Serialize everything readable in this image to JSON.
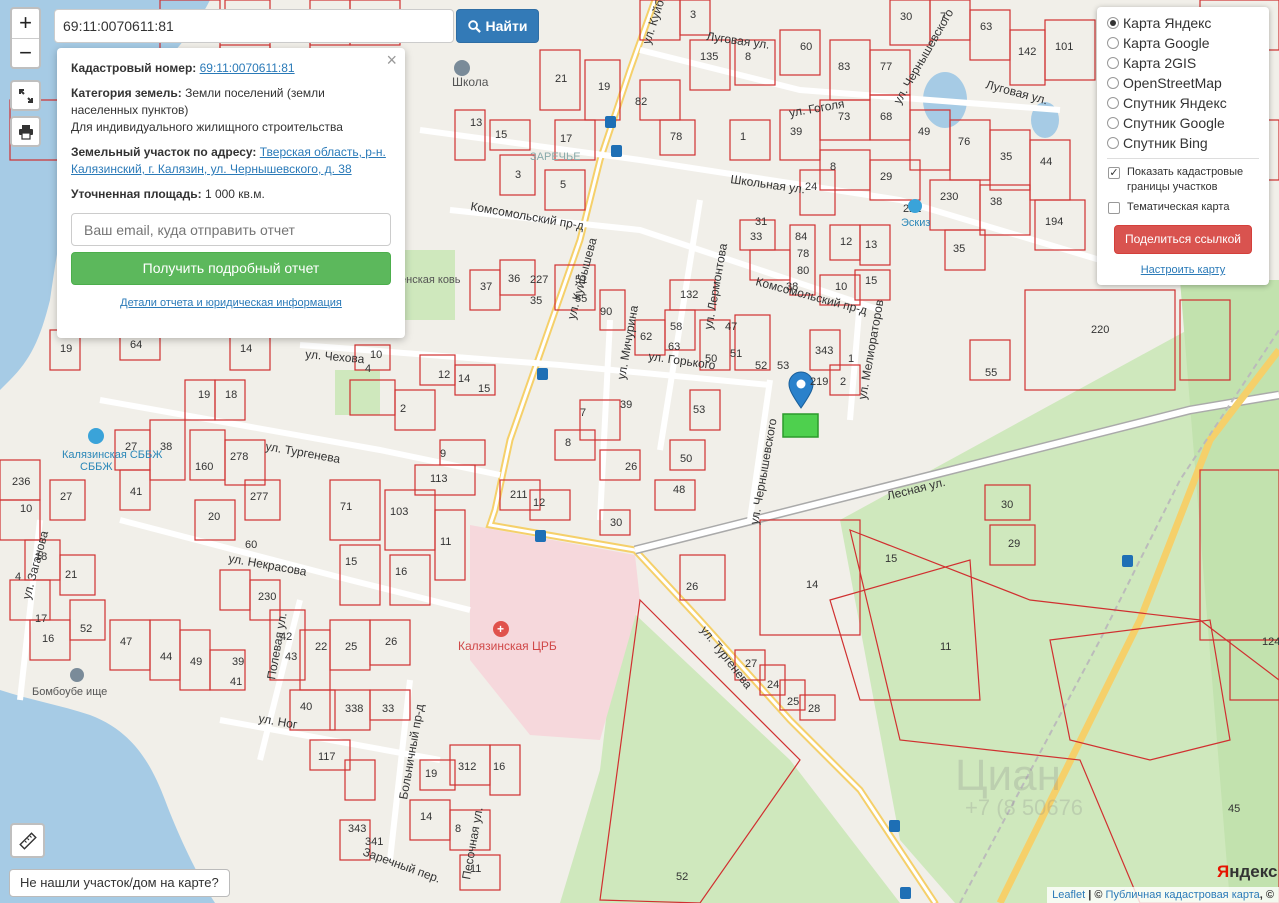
{
  "search": {
    "value": "69:11:0070611:81",
    "button_label": "Найти"
  },
  "zoom": {
    "in_label": "+",
    "out_label": "−"
  },
  "info_panel": {
    "cadastral_label": "Кадастровый номер:",
    "cadastral_value": "69:11:0070611:81",
    "category_label": "Категория земель:",
    "category_value": "Земли поселений (земли населенных пунктов)",
    "usage_value": "Для индивидуального жилищного строительства",
    "address_label": "Земельный участок по адресу:",
    "address_value": "Тверская область, р-н. Калязинский, г. Калязин, ул. Чернышевского, д. 38",
    "area_label": "Уточненная площадь:",
    "area_value": "1 000 кв.м.",
    "email_placeholder": "Ваш email, куда отправить отчет",
    "report_button": "Получить подробный отчет",
    "details_link": "Детали отчета и юридическая информация",
    "close": "×"
  },
  "layers": {
    "options": [
      {
        "label": "Карта Яндекс",
        "selected": true
      },
      {
        "label": "Карта Google",
        "selected": false
      },
      {
        "label": "Карта 2GIS",
        "selected": false
      },
      {
        "label": "OpenStreetMap",
        "selected": false
      },
      {
        "label": "Спутник Яндекс",
        "selected": false
      },
      {
        "label": "Спутник Google",
        "selected": false
      },
      {
        "label": "Спутник Bing",
        "selected": false
      }
    ],
    "show_borders_label": "Показать кадастровые границы участков",
    "show_borders": true,
    "thematic_label": "Тематическая карта",
    "thematic": false,
    "share_button": "Поделиться ссылкой",
    "configure_link": "Настроить карту"
  },
  "not_found_button": "Не нашли участок/дом на карте?",
  "attribution": {
    "leaflet": "Leaflet",
    "separator": " | © ",
    "source": "Публичная кадастровая карта",
    "suffix": ", ©"
  },
  "yandex_logo": {
    "first": "Я",
    "rest": "ндекс"
  },
  "map_labels": {
    "streets": {
      "kuibysheva": "ул. Куйбышева",
      "kuibysheva_top": "ул. Куйбы",
      "shkolnaya": "Школьная ул.",
      "komsomolsky": "Комсомольский пр-д",
      "komsomolsky2": "Комсомольский пр-д",
      "chekhova": "ул. Чехова",
      "turgeneva": "ул. Тургенева",
      "turgeneva2": "ул. Тургенева",
      "nekrasova": "ул. Некрасова",
      "lesnaya": "Лесная ул.",
      "chernyshevskogo": "ул. Чернышевского",
      "chernyshevskogo_top": "ул. Чернышевского",
      "gorkogo": "ул. Горького",
      "michurina": "ул. Мичурина",
      "lermontova": "ул. Лермонтова",
      "melioratorov": "ул. Мелиораторов",
      "gogolya": "ул. Гоголя",
      "lugovaya": "Луговая ул.",
      "lugovaya2": "Луговая ул.",
      "zagorskaya": "ул. Заганова",
      "polevaya": "Полевая ул.",
      "bolnichny": "Больничный пр-д",
      "pesochnaya": "Песочная ул.",
      "zarechny": "Заречный пер.",
      "nogina": "ул. Ног"
    },
    "pois": {
      "school": "Школа",
      "hospital": "Калязинская ЦРБ",
      "sbbzh": "Калязинская СББЖ",
      "eskiz": "Эскиз",
      "church": "енская ковь",
      "zarechye": "ЗАРЕЧЬЕ"
    },
    "watermark_line1": "Циан",
    "watermark_line2": "+7 (8 50676",
    "bombo": "Бомбоубе ище"
  }
}
